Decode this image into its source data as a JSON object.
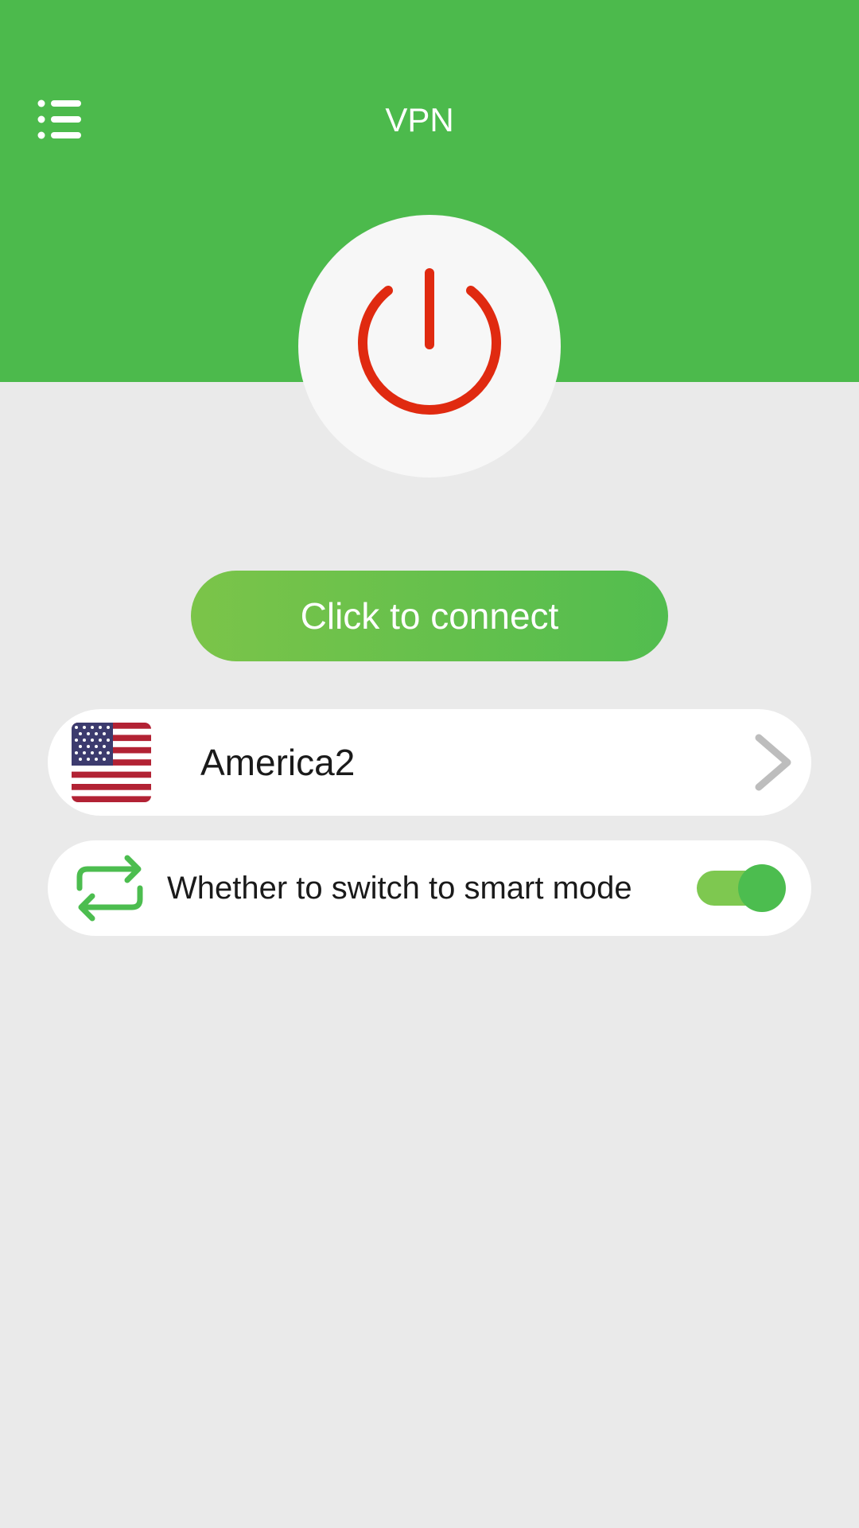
{
  "app": {
    "title": "VPN"
  },
  "colors": {
    "header_bg": "#4cba4c",
    "page_bg": "#eaeaea",
    "power_icon": "#e02a10",
    "accent_green": "#52bd4f",
    "chevron": "#bdbdbd"
  },
  "icons": {
    "menu": "list-menu-icon",
    "power": "power-icon",
    "flag": "us-flag-icon",
    "chevron": "chevron-right-icon",
    "switch": "repeat-switch-icon"
  },
  "connect": {
    "label": "Click to connect"
  },
  "server": {
    "name": "America2"
  },
  "smart_mode": {
    "label": "Whether to switch to smart mode",
    "enabled": true
  }
}
